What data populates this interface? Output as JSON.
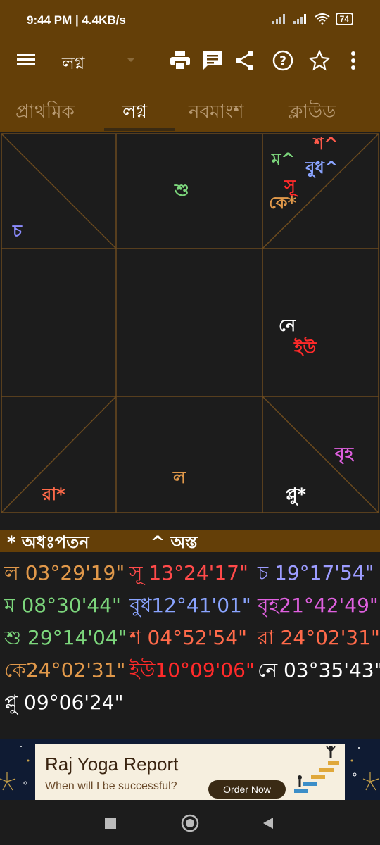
{
  "status": {
    "time": "9:44 PM | 4.4KB/s",
    "battery": "74"
  },
  "toolbar": {
    "title": "লগ্ন",
    "icons": [
      "menu-icon",
      "print-icon",
      "message-icon",
      "share-icon",
      "help-icon",
      "star-icon",
      "more-icon"
    ]
  },
  "tabs": [
    "প্রাথমিক",
    "লগ্ন",
    "নবমাংশ",
    "ক্লাউড"
  ],
  "active_tab": "লগ্ন",
  "chart": {
    "houses": [
      {
        "planets": []
      },
      {
        "planets": [
          "শু"
        ]
      },
      {
        "planets": [
          "শ^",
          "ম^",
          "বুধ^",
          "সূ",
          "কে*"
        ]
      },
      {
        "planets": [
          "চ"
        ]
      },
      {
        "planets": []
      },
      {
        "planets": [
          "নে",
          "ইউ"
        ]
      },
      {
        "planets": [
          "রা*"
        ]
      },
      {
        "planets": [
          "ল"
        ]
      },
      {
        "planets": [
          "প্লু*",
          "বৃহ"
        ]
      }
    ],
    "colors": {
      "শু": "#7cd67c",
      "শ^": "#ff5a4a",
      "ম^": "#7cd67c",
      "বুধ^": "#8aa4ff",
      "সূ": "#ff2a2a",
      "কে*": "#e0984a",
      "চ": "#8c8cff",
      "নে": "#ffffff",
      "ইউ": "#ff2a2a",
      "রা*": "#ff6a4a",
      "ল": "#e0984a",
      "প্লু*": "#ffffff",
      "বৃহ": "#e060e0"
    }
  },
  "legend": {
    "fall": "* অধঃপতন",
    "combust": "^ অস্ত"
  },
  "positions": [
    [
      {
        "label": "ল",
        "value": "03°29'19\"",
        "color": "#e0984a"
      },
      {
        "label": "সূ",
        "value": "13°24'17\"",
        "color": "#ff4a4a"
      },
      {
        "label": "চ",
        "value": "19°17'54\"",
        "color": "#9c9cff"
      }
    ],
    [
      {
        "label": "ম",
        "value": "08°30'44\"",
        "color": "#7cd67c"
      },
      {
        "label": "বুধ",
        "value": "12°41'01\"",
        "color": "#8aa4ff"
      },
      {
        "label": "বৃহ",
        "value": "21°42'49\"",
        "color": "#e060e0"
      }
    ],
    [
      {
        "label": "শু",
        "value": "29°14'04\"",
        "color": "#7cd67c"
      },
      {
        "label": "শ",
        "value": "04°52'54\"",
        "color": "#ff6a4a"
      },
      {
        "label": "রা",
        "value": "24°02'31\"",
        "color": "#ff6a4a"
      }
    ],
    [
      {
        "label": "কে",
        "value": "24°02'31\"",
        "color": "#e0984a"
      },
      {
        "label": "ইউ",
        "value": "10°09'06\"",
        "color": "#ff2a2a"
      },
      {
        "label": "নে",
        "value": "03°35'43\"",
        "color": "#ffffff"
      }
    ],
    [
      {
        "label": "প্লু",
        "value": "09°06'24\"",
        "color": "#ffffff"
      }
    ]
  ],
  "ad": {
    "title": "Raj Yoga Report",
    "subtitle": "When will I be successful?",
    "cta": "Order Now"
  },
  "navbar": [
    "recents-button",
    "home-button",
    "back-button"
  ]
}
